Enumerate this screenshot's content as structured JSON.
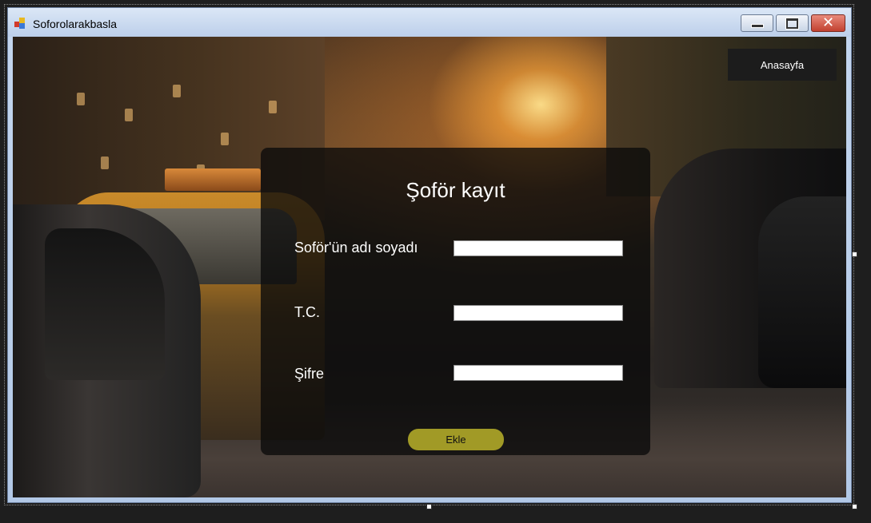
{
  "window": {
    "title": "Soforolarakbasla",
    "controls": {
      "minimize_icon": "minimize-icon",
      "maximize_icon": "maximize-icon",
      "close_icon": "close-icon"
    }
  },
  "nav": {
    "home_label": "Anasayfa"
  },
  "form": {
    "title": "Şoför kayıt",
    "fields": [
      {
        "label": "Soför'ün adı soyadı",
        "value": ""
      },
      {
        "label": "T.C.",
        "value": ""
      },
      {
        "label": "Şifre",
        "value": ""
      }
    ],
    "submit_label": "Ekle"
  },
  "colors": {
    "panel_bg": "#0a0a0a",
    "submit_bg": "#a19a26",
    "nav_bg": "#1c1c1c"
  }
}
